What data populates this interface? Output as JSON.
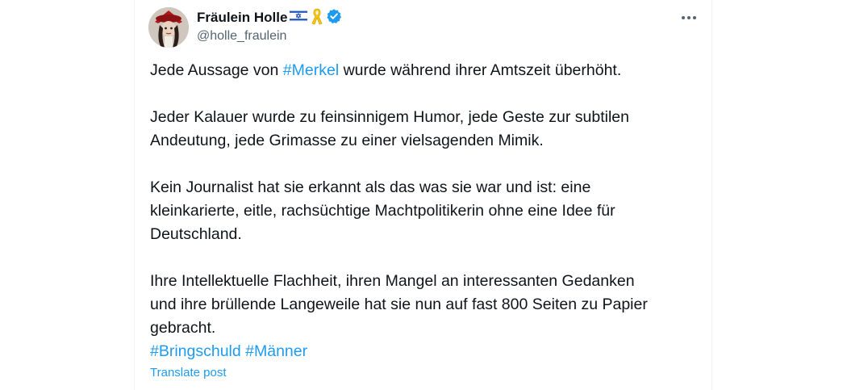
{
  "author": {
    "display_name": "Fräulein Holle",
    "handle": "@holle_fraulein",
    "flag_icon": "israel-flag-icon",
    "ribbon_icon": "yellow-ribbon-icon",
    "verified_icon": "verified-badge-icon",
    "verified_color": "#1d9bf0"
  },
  "more_icon": "more-horizontal-icon",
  "post": {
    "p1_before": "Jede Aussage von ",
    "p1_hashtag": "#Merkel",
    "p1_after": " wurde während ihrer Amtszeit überhöht.",
    "p2_line1": "Jeder Kalauer wurde zu feinsinnigem Humor, jede Geste zur subtilen",
    "p2_line2": "Andeutung, jede Grimasse zu einer vielsagenden Mimik.",
    "p3_line1": "Kein Journalist hat sie erkannt als das was sie war und ist: eine",
    "p3_line2": "kleinkarierte, eitle, rachsüchtige Machtpolitikerin ohne eine Idee für",
    "p3_line3": "Deutschland.",
    "p4_line1": "Ihre Intellektuelle Flachheit, ihren Mangel an interessanten Gedanken",
    "p4_line2": "und ihre brüllende Langeweile hat sie nun auf fast 800 Seiten zu Papier",
    "p4_line3": "gebracht.",
    "hashtags": [
      "#Bringschuld",
      "#Männer"
    ]
  },
  "translate_label": "Translate post",
  "colors": {
    "link": "#1d9bf0",
    "text": "#0f1419",
    "secondary": "#536471"
  }
}
